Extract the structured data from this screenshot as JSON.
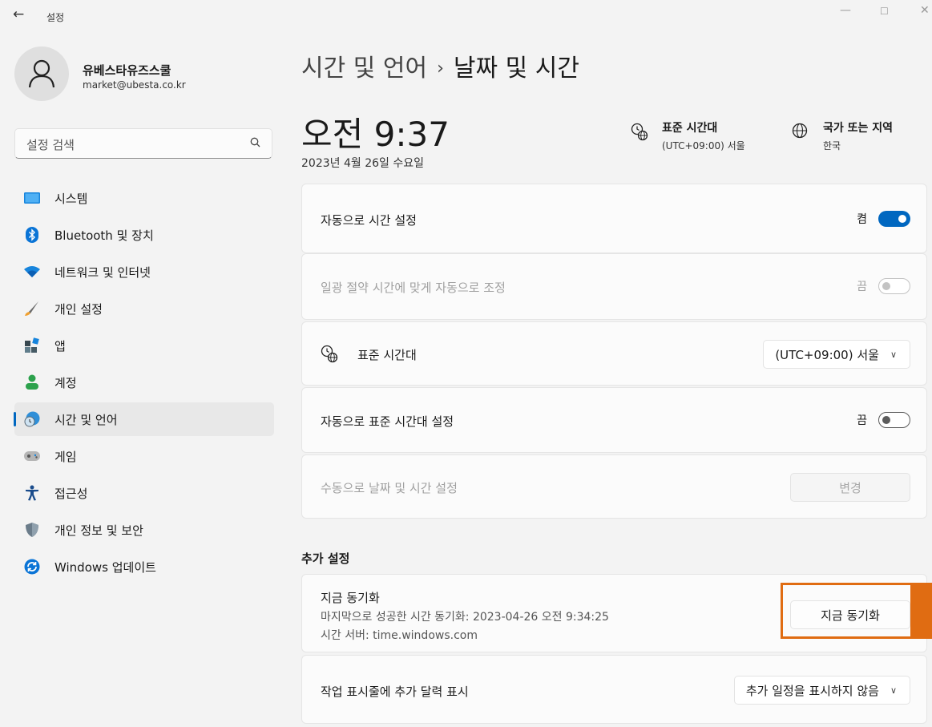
{
  "window": {
    "title": "설정",
    "back_glyph": "←",
    "minimize_glyph": "—",
    "maximize_glyph": "☐",
    "close_glyph": "✕"
  },
  "profile": {
    "name": "유베스타유즈스쿨",
    "email": "market@ubesta.co.kr"
  },
  "search": {
    "placeholder": "설정 검색",
    "icon": "search-icon"
  },
  "nav": {
    "items": [
      {
        "label": "시스템",
        "icon": "system-icon",
        "color": "#0a74d6"
      },
      {
        "label": "Bluetooth 및 장치",
        "icon": "bluetooth-icon",
        "color": "#0a74d6"
      },
      {
        "label": "네트워크 및 인터넷",
        "icon": "wifi-icon",
        "color": "#0a74d6"
      },
      {
        "label": "개인 설정",
        "icon": "brush-icon",
        "color": "#3a3a3a"
      },
      {
        "label": "앱",
        "icon": "apps-icon",
        "color": "#455a64"
      },
      {
        "label": "계정",
        "icon": "account-icon",
        "color": "#2ca14c"
      },
      {
        "label": "시간 및 언어",
        "icon": "time-language-icon",
        "color": "#2f8fd8",
        "active": true
      },
      {
        "label": "게임",
        "icon": "gamepad-icon",
        "color": "#8a8a8a"
      },
      {
        "label": "접근성",
        "icon": "accessibility-icon",
        "color": "#1a4c8c"
      },
      {
        "label": "개인 정보 및 보안",
        "icon": "shield-icon",
        "color": "#6b7c8a"
      },
      {
        "label": "Windows 업데이트",
        "icon": "update-icon",
        "color": "#0a74d6"
      }
    ]
  },
  "breadcrumb": {
    "parent": "시간 및 언어",
    "separator": "›",
    "current": "날짜 및 시간"
  },
  "clock": {
    "time": "오전 9:37",
    "date": "2023년 4월 26일 수요일"
  },
  "timezone_info": {
    "title": "표준 시간대",
    "value": "(UTC+09:00) 서울"
  },
  "region_info": {
    "title": "국가 또는 지역",
    "value": "한국"
  },
  "settings": {
    "auto_time": {
      "label": "자동으로 시간 설정",
      "state_text": "켬",
      "on": true
    },
    "dst": {
      "label": "일광 절약 시간에 맞게 자동으로 조정",
      "state_text": "끔",
      "on": false,
      "disabled": true
    },
    "timezone": {
      "label": "표준 시간대",
      "value": "(UTC+09:00) 서울"
    },
    "auto_timezone": {
      "label": "자동으로 표준 시간대 설정",
      "state_text": "끔",
      "on": false
    },
    "manual": {
      "label": "수동으로 날짜 및 시간 설정",
      "button": "변경",
      "disabled": true
    }
  },
  "additional": {
    "title": "추가 설정",
    "sync": {
      "title": "지금 동기화",
      "last_sync": "마지막으로 성공한 시간 동기화: 2023-04-26 오전 9:34:25",
      "server": "시간 서버: time.windows.com",
      "button": "지금 동기화"
    },
    "calendar": {
      "label": "작업 표시줄에 추가 달력 표시",
      "value": "추가 일정을 표시하지 않음"
    }
  },
  "colors": {
    "accent": "#0067c0",
    "highlight": "#e06c12"
  }
}
